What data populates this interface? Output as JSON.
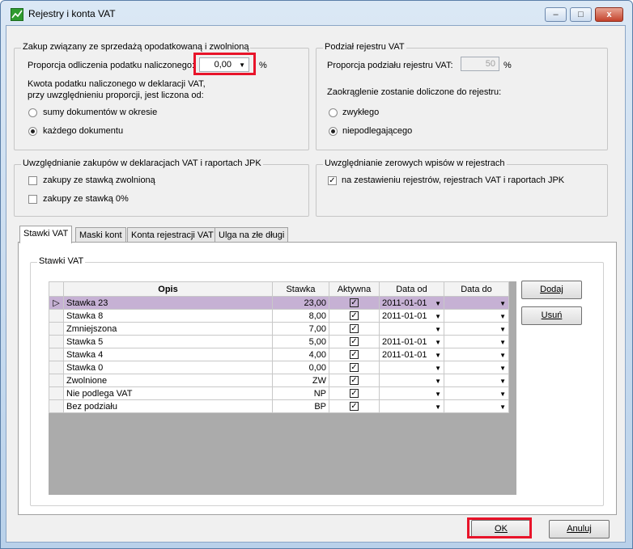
{
  "window": {
    "title": "Rejestry i konta VAT",
    "minimize_label": "–",
    "maximize_label": "□",
    "close_label": "x"
  },
  "zakup": {
    "title": "Zakup związany ze sprzedażą opodatkowaną i zwolnioną",
    "proporcja_label": "Proporcja odliczenia podatku naliczonego:",
    "proporcja_value": "0,00",
    "percent": "%",
    "kwota_line1": "Kwota podatku naliczonego w deklaracji VAT,",
    "kwota_line2": "przy uwzględnieniu proporcji, jest liczona od:",
    "radio1_label": "sumy dokumentów w okresie",
    "radio2_label": "każdego dokumentu"
  },
  "podzial": {
    "title": "Podział rejestru VAT",
    "proporcja_label": "Proporcja podziału rejestru VAT:",
    "proporcja_value": "50",
    "percent": "%",
    "zaokraglenie_label": "Zaokrąglenie zostanie doliczone do rejestru:",
    "radio1_label": "zwykłego",
    "radio2_label": "niepodlegającego"
  },
  "uwzgl_zakupow": {
    "title": "Uwzględnianie zakupów w deklaracjach VAT i raportach JPK",
    "check1_label": "zakupy ze stawką zwolnioną",
    "check2_label": "zakupy ze stawką 0%"
  },
  "uwzgl_zerowych": {
    "title": "Uwzględnianie zerowych wpisów w rejestrach",
    "check1_label": "na zestawieniu rejestrów, rejestrach VAT i raportach JPK"
  },
  "tabs": [
    "Stawki VAT",
    "Maski kont",
    "Konta rejestracji VAT",
    "Ulga na złe długi"
  ],
  "stawki": {
    "group_title": "Stawki VAT",
    "columns": [
      "Opis",
      "Stawka",
      "Aktywna",
      "Data od",
      "Data do"
    ],
    "rows": [
      {
        "opis": "Stawka 23",
        "stawka": "23,00",
        "aktywna": true,
        "data_od": "2011-01-01",
        "data_do": ""
      },
      {
        "opis": "Stawka 8",
        "stawka": "8,00",
        "aktywna": true,
        "data_od": "2011-01-01",
        "data_do": ""
      },
      {
        "opis": "Zmniejszona",
        "stawka": "7,00",
        "aktywna": true,
        "data_od": "",
        "data_do": ""
      },
      {
        "opis": "Stawka 5",
        "stawka": "5,00",
        "aktywna": true,
        "data_od": "2011-01-01",
        "data_do": ""
      },
      {
        "opis": "Stawka 4",
        "stawka": "4,00",
        "aktywna": true,
        "data_od": "2011-01-01",
        "data_do": ""
      },
      {
        "opis": "Stawka 0",
        "stawka": "0,00",
        "aktywna": true,
        "data_od": "",
        "data_do": ""
      },
      {
        "opis": "Zwolnione",
        "stawka": "ZW",
        "aktywna": true,
        "data_od": "",
        "data_do": ""
      },
      {
        "opis": "Nie podlega VAT",
        "stawka": "NP",
        "aktywna": true,
        "data_od": "",
        "data_do": ""
      },
      {
        "opis": "Bez podziału",
        "stawka": "BP",
        "aktywna": true,
        "data_od": "",
        "data_do": ""
      }
    ],
    "dodaj_label": "Dodaj",
    "usun_label": "Usuń"
  },
  "footer": {
    "ok_label": "OK",
    "anuluj_label": "Anuluj"
  },
  "colors": {
    "highlight": "#e8142a",
    "selected_row": "#c6b1d4"
  }
}
